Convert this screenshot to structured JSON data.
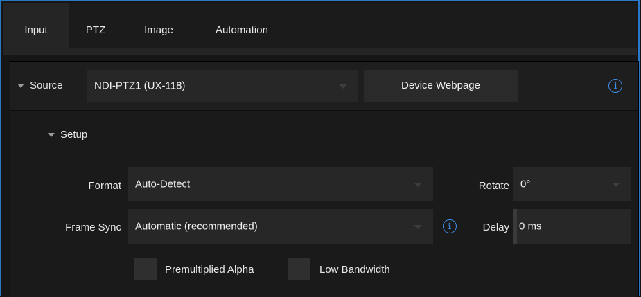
{
  "tabs": [
    {
      "label": "Input",
      "active": true
    },
    {
      "label": "PTZ",
      "active": false
    },
    {
      "label": "Image",
      "active": false
    },
    {
      "label": "Automation",
      "active": false
    }
  ],
  "source": {
    "label": "Source",
    "value": "NDI-PTZ1 (UX-118)",
    "device_webpage_label": "Device Webpage",
    "info_icon": "i"
  },
  "setup": {
    "label": "Setup",
    "format": {
      "label": "Format",
      "value": "Auto-Detect"
    },
    "rotate": {
      "label": "Rotate",
      "value": "0°"
    },
    "frame_sync": {
      "label": "Frame Sync",
      "value": "Automatic (recommended)",
      "info_icon": "i"
    },
    "delay": {
      "label": "Delay",
      "value": "0 ms"
    },
    "premultiplied_alpha": {
      "label": "Premultiplied Alpha",
      "checked": false
    },
    "low_bandwidth": {
      "label": "Low Bandwidth",
      "checked": false
    }
  },
  "colors": {
    "accent": "#2a78c8",
    "info": "#3d8ee8",
    "background": "#161616"
  }
}
